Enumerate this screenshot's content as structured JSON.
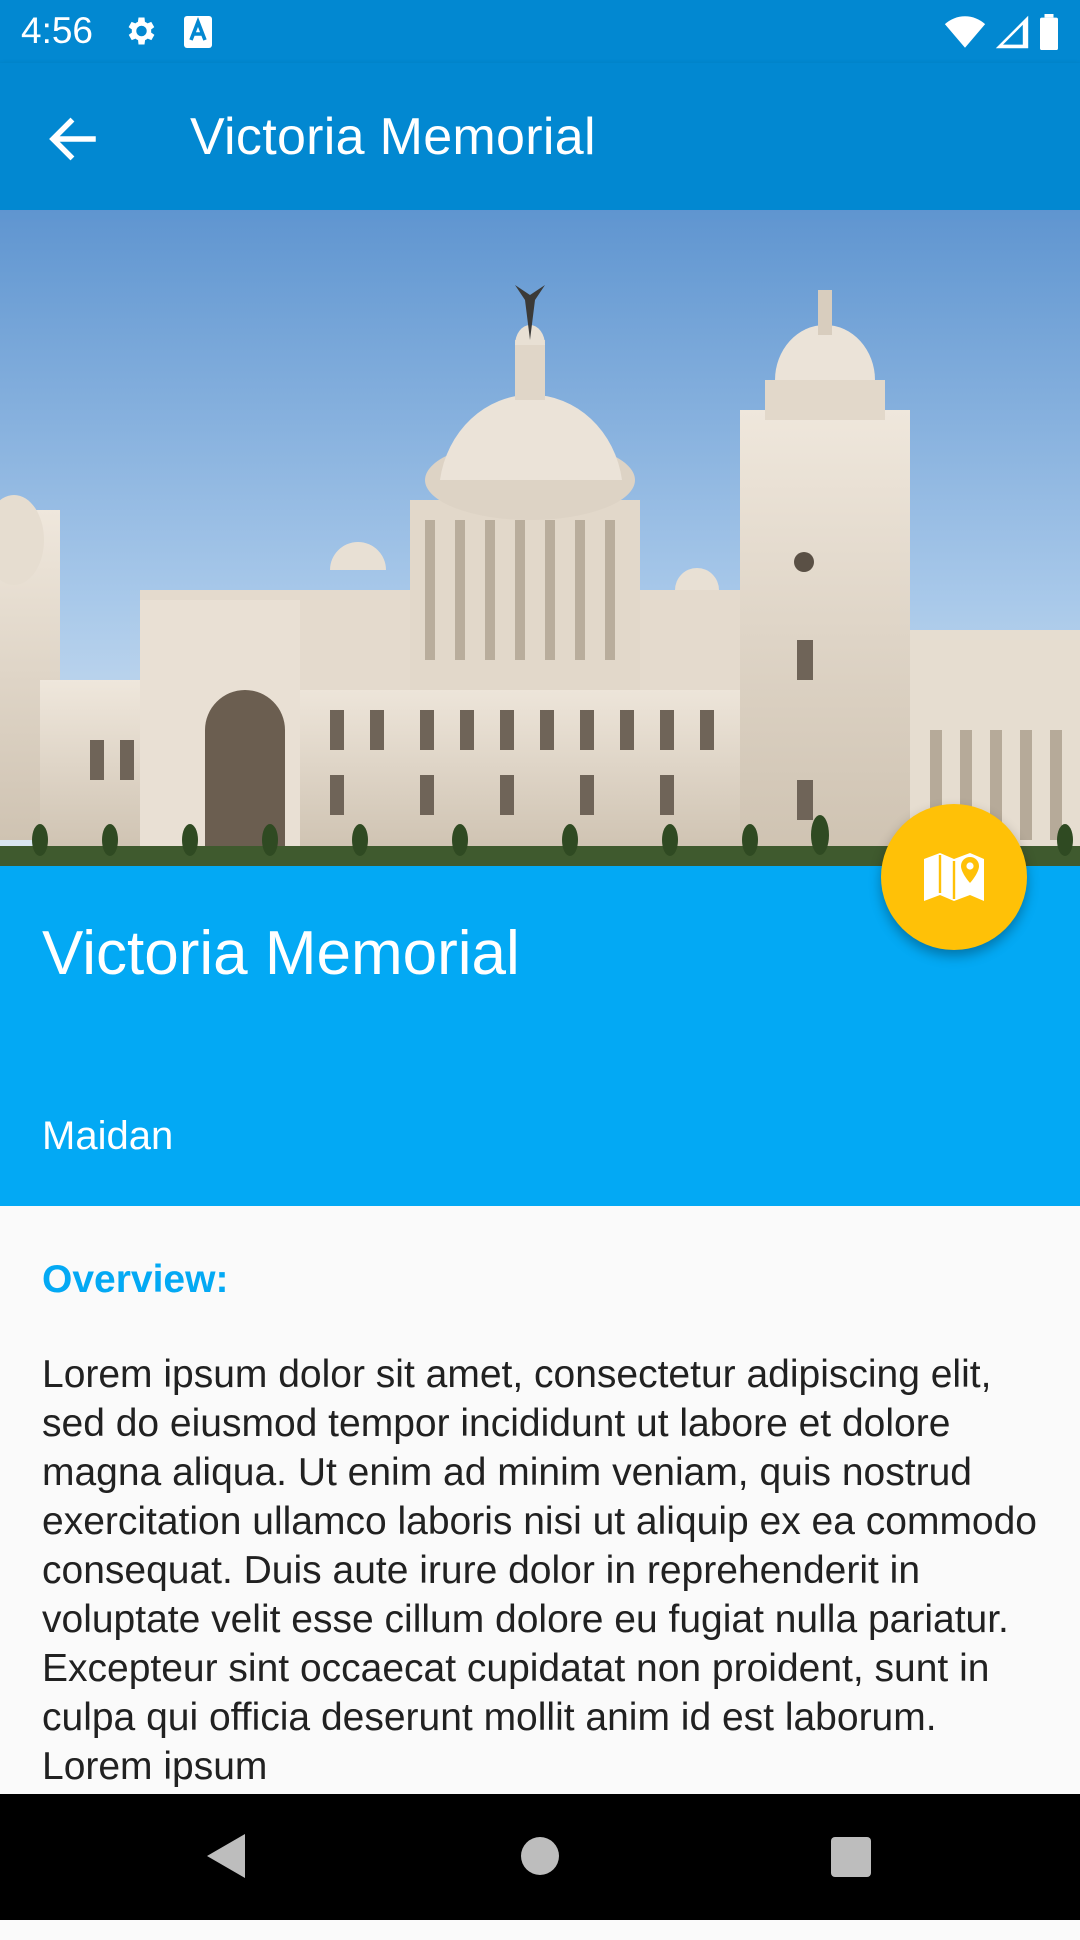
{
  "status_bar": {
    "time": "4:56",
    "icons": [
      "gear-icon",
      "font-a-icon",
      "wifi-icon",
      "signal-icon",
      "battery-icon"
    ]
  },
  "app_bar": {
    "title": "Victoria Memorial",
    "back_icon": "arrow-left-icon",
    "color": "#0288d1"
  },
  "hero": {
    "image": "victoria-memorial-photo"
  },
  "place": {
    "name": "Victoria Memorial",
    "area": "Maidan",
    "panel_color": "#03a9f4"
  },
  "fab": {
    "icon": "map-icon",
    "color": "#ffc107"
  },
  "overview": {
    "label": "Overview:",
    "text": "Lorem ipsum dolor sit amet, consectetur adipiscing elit, sed do eiusmod tempor incididunt ut labore et dolore magna aliqua. Ut enim ad minim veniam, quis nostrud exercitation ullamco laboris nisi ut aliquip ex ea commodo consequat. Duis aute irure dolor in reprehenderit in voluptate velit esse cillum dolore eu fugiat nulla pariatur. Excepteur sint occaecat cupidatat non proident, sunt in culpa qui officia deserunt mollit anim id est laborum. Lorem ipsum"
  },
  "nav_bar": {
    "icons": [
      "back-triangle-icon",
      "home-circle-icon",
      "recents-square-icon"
    ]
  }
}
